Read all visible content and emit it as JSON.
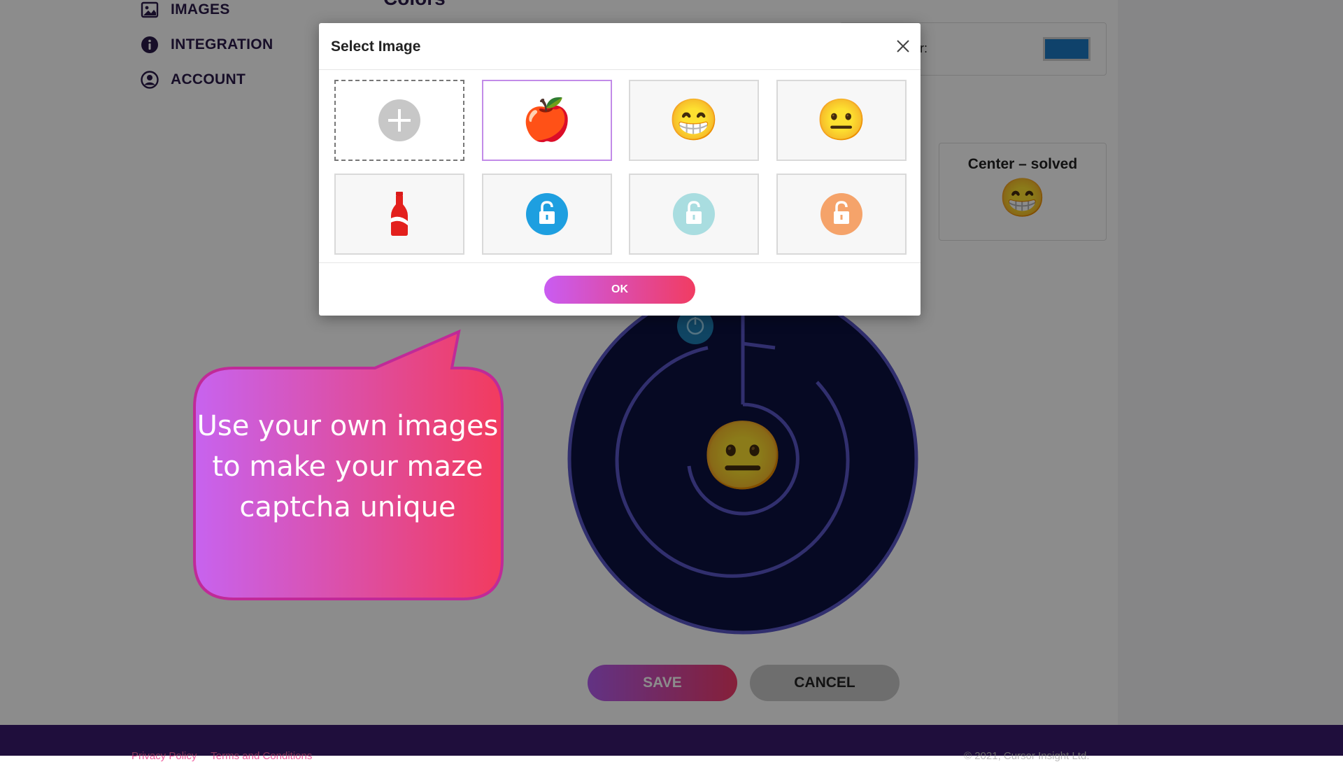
{
  "nav": {
    "items": [
      {
        "label": "IMAGES",
        "icon": "image-icon"
      },
      {
        "label": "INTEGRATION",
        "icon": "info-icon"
      },
      {
        "label": "ACCOUNT",
        "icon": "account-icon"
      }
    ]
  },
  "main": {
    "section_title": "Colors",
    "color_field_label": "r:",
    "color_value": "#1c78c4",
    "center_card": {
      "title": "Center – solved",
      "emoji": "😁"
    },
    "maze_center_emoji": "😐",
    "save_label": "SAVE",
    "cancel_label": "CANCEL"
  },
  "footer": {
    "links": [
      "Privacy Policy",
      "Terms and Conditions"
    ],
    "copyright": "© 2021, Cursor Insight Ltd."
  },
  "callout": {
    "text": "Use your own images to make your maze captcha unique"
  },
  "modal": {
    "title": "Select Image",
    "ok_label": "OK",
    "tiles": [
      {
        "type": "add",
        "icon": "plus-icon"
      },
      {
        "type": "emoji",
        "emoji": "🍎",
        "icon": "apple-icon",
        "selected": true
      },
      {
        "type": "emoji",
        "emoji": "😁",
        "icon": "grinning-face-icon"
      },
      {
        "type": "emoji",
        "emoji": "😐",
        "icon": "neutral-face-icon"
      },
      {
        "type": "emoji",
        "emoji": "🥤",
        "icon": "soda-bottle-icon"
      },
      {
        "type": "lock",
        "icon": "unlock-icon",
        "color": "#1e9fe0"
      },
      {
        "type": "lock",
        "icon": "unlock-icon",
        "color": "#a9dde0"
      },
      {
        "type": "lock",
        "icon": "unlock-icon",
        "color": "#f5a36a"
      }
    ]
  },
  "colors": {
    "brand_dark": "#2b1a4a",
    "gradient_start": "#c95cf2",
    "gradient_end": "#f13c62",
    "maze_bg": "#0b1140",
    "maze_line": "#5a57c9",
    "footer_bg": "#3a1a6e"
  }
}
